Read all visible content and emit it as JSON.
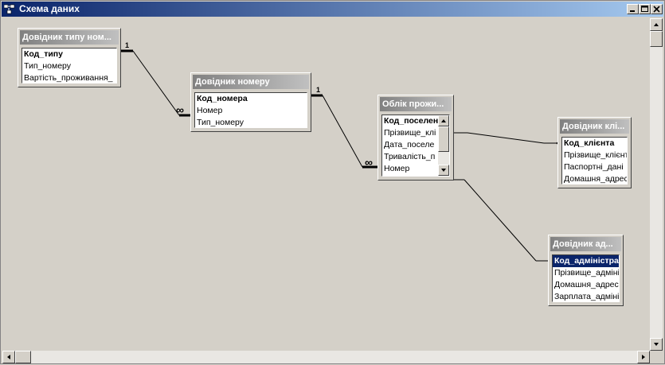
{
  "window": {
    "title": "Схема даних",
    "icon": "relationships-icon",
    "buttons": [
      "minimize-icon",
      "maximize-icon",
      "close-icon"
    ]
  },
  "tables": [
    {
      "id": "room-type",
      "title": "Довідник типу ном...",
      "fields": [
        {
          "label": "Код_типу",
          "pk": true
        },
        {
          "label": "Тип_номеру"
        },
        {
          "label": "Вартість_проживання_"
        }
      ]
    },
    {
      "id": "room",
      "title": "Довідник номеру",
      "fields": [
        {
          "label": "Код_номера",
          "pk": true
        },
        {
          "label": "Номер"
        },
        {
          "label": "Тип_номеру"
        }
      ]
    },
    {
      "id": "settlement",
      "title": "Облік прожи...",
      "fields": [
        {
          "label": "Код_поселен",
          "pk": true
        },
        {
          "label": "Прізвище_клі"
        },
        {
          "label": "Дата_поселе"
        },
        {
          "label": "Тривалість_п"
        },
        {
          "label": "Номер"
        }
      ]
    },
    {
      "id": "client",
      "title": "Довідник клі...",
      "fields": [
        {
          "label": "Код_клієнта",
          "pk": true
        },
        {
          "label": "Прізвище_клієнт"
        },
        {
          "label": "Паспортні_дані"
        },
        {
          "label": "Домашня_адрес"
        }
      ]
    },
    {
      "id": "admin",
      "title": "Довідник ад...",
      "fields": [
        {
          "label": "Код_адміністра",
          "pk": true,
          "selected": true
        },
        {
          "label": "Прізвище_адміні"
        },
        {
          "label": "Домашня_адрес"
        },
        {
          "label": "Зарплата_адміні"
        }
      ]
    }
  ],
  "relationships": [
    {
      "from": "room-type",
      "to": "room",
      "one_label": "1",
      "many_label": "∞"
    },
    {
      "from": "room",
      "to": "settlement",
      "one_label": "1",
      "many_label": "∞"
    },
    {
      "from": "settlement",
      "to": "client"
    },
    {
      "from": "settlement",
      "to": "admin"
    }
  ]
}
